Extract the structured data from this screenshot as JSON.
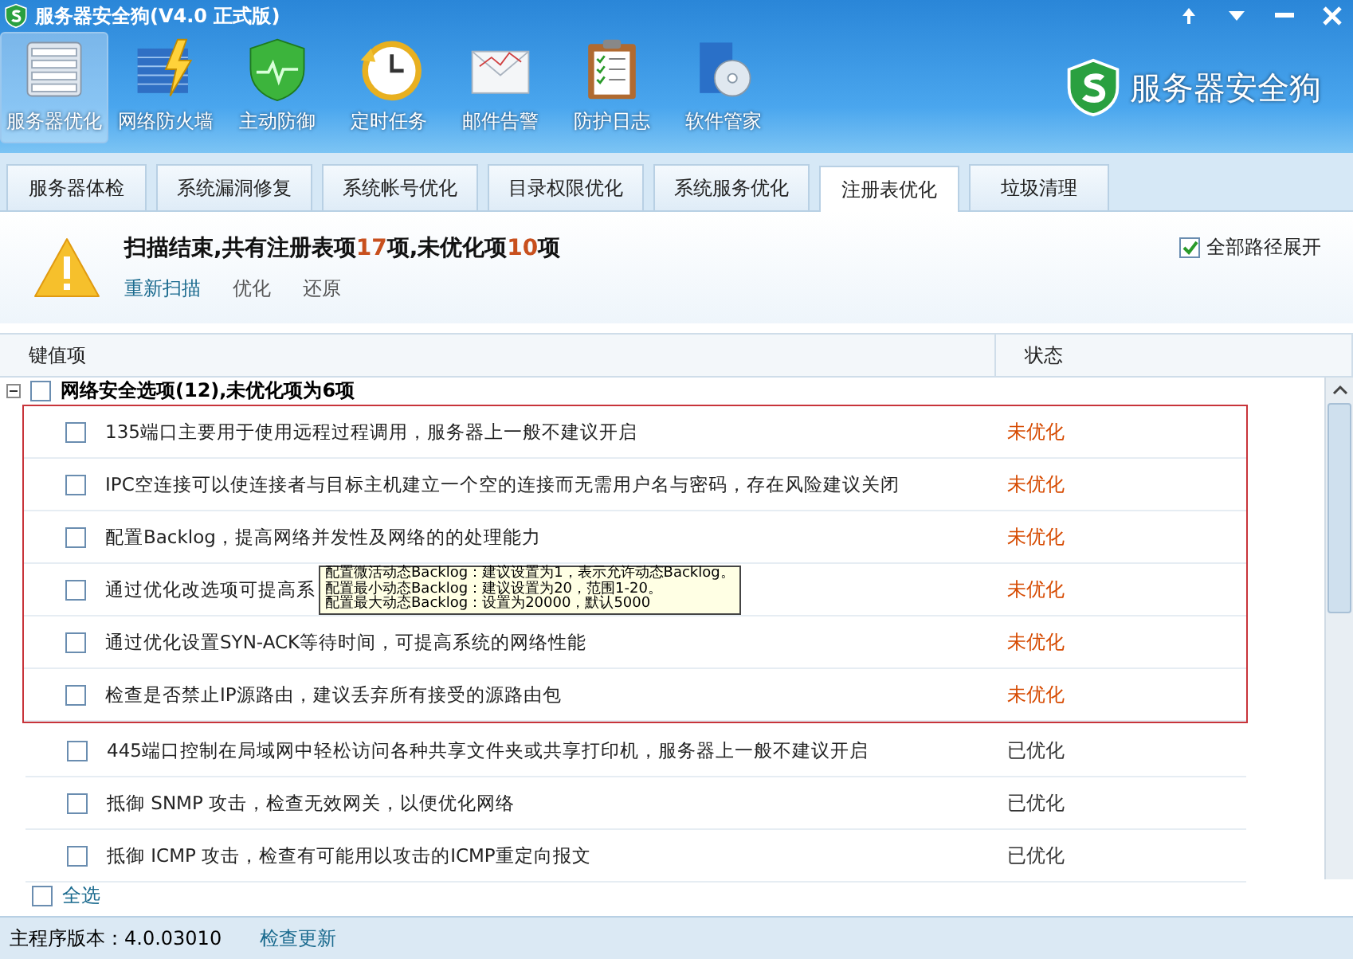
{
  "window": {
    "title": "服务器安全狗(V4.0 正式版)"
  },
  "toolbar": [
    {
      "label": "服务器优化",
      "kind": "server",
      "selected": true
    },
    {
      "label": "网络防火墙",
      "kind": "firewall",
      "selected": false
    },
    {
      "label": "主动防御",
      "kind": "shield",
      "selected": false
    },
    {
      "label": "定时任务",
      "kind": "clock",
      "selected": false
    },
    {
      "label": "邮件告警",
      "kind": "mail",
      "selected": false
    },
    {
      "label": "防护日志",
      "kind": "log",
      "selected": false
    },
    {
      "label": "软件管家",
      "kind": "software",
      "selected": false
    }
  ],
  "brand": "服务器安全狗",
  "tabs": [
    {
      "label": "服务器体检",
      "selected": false
    },
    {
      "label": "系统漏洞修复",
      "selected": false
    },
    {
      "label": "系统帐号优化",
      "selected": false
    },
    {
      "label": "目录权限优化",
      "selected": false
    },
    {
      "label": "系统服务优化",
      "selected": false
    },
    {
      "label": "注册表优化",
      "selected": true
    },
    {
      "label": "垃圾清理",
      "selected": false
    }
  ],
  "summary": {
    "message": "扫描结束,共有注册表项**17**项,未优化项**10**项",
    "actions": [
      "重新扫描",
      "优化",
      "还原"
    ],
    "expand_all": {
      "label": "全部路径展开",
      "checked": true
    }
  },
  "table": {
    "columns": [
      "键值项",
      "状态"
    ],
    "group": {
      "label": "网络安全选项(12),未优化项为6项",
      "expanded": true,
      "checked": false
    },
    "framed_rows": [
      {
        "text": "135端口主要用于使用远程过程调用，服务器上一般不建议开启",
        "status": "未优化",
        "optimized": false,
        "checked": false
      },
      {
        "text": "IPC空连接可以使连接者与目标主机建立一个空的连接而无需用户名与密码，存在风险建议关闭",
        "status": "未优化",
        "optimized": false,
        "checked": false
      },
      {
        "text": "配置Backlog，提高网络并发性及网络的的处理能力",
        "status": "未优化",
        "optimized": false,
        "checked": false
      },
      {
        "text": "通过优化改选项可提高系",
        "status": "未优化",
        "optimized": false,
        "checked": false,
        "tooltip": [
          "配置微活动态Backlog：建议设置为1，表示允许动态Backlog。",
          "配置最小动态Backlog：建议设置为20，范围1-20。",
          "配置最大动态Backlog：设置为20000，默认5000"
        ]
      },
      {
        "text": "通过优化设置SYN-ACK等待时间，可提高系统的网络性能",
        "status": "未优化",
        "optimized": false,
        "checked": false
      },
      {
        "text": "检查是否禁止IP源路由，建议丢弃所有接受的源路由包",
        "status": "未优化",
        "optimized": false,
        "checked": false
      }
    ],
    "rows": [
      {
        "text": "445端口控制在局域网中轻松访问各种共享文件夹或共享打印机，服务器上一般不建议开启",
        "status": "已优化",
        "optimized": true,
        "checked": false
      },
      {
        "text": "抵御 SNMP 攻击，检查无效网关，以便优化网络",
        "status": "已优化",
        "optimized": true,
        "checked": false
      },
      {
        "text": "抵御 ICMP 攻击，检查有可能用以攻击的ICMP重定向报文",
        "status": "已优化",
        "optimized": true,
        "checked": false
      }
    ]
  },
  "select_all": {
    "label": "全选",
    "checked": false
  },
  "status_bar": {
    "version": "主程序版本：4.0.03010",
    "link": "检查更新"
  }
}
